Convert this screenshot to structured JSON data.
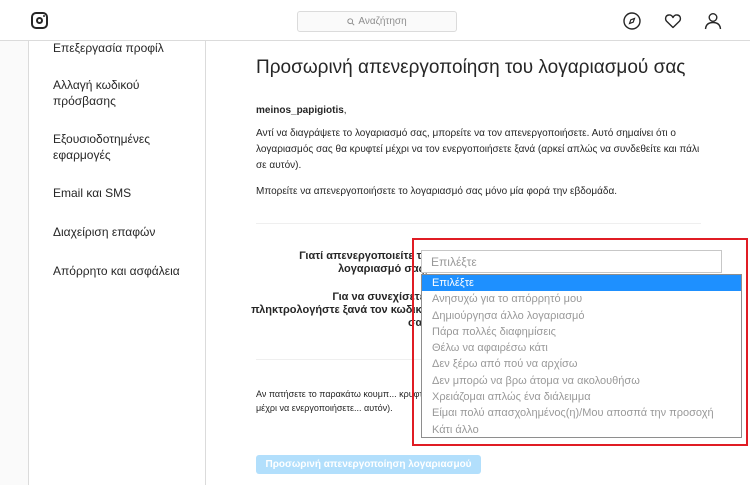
{
  "nav": {
    "search_placeholder": "Αναζήτηση",
    "icons": [
      "instagram-logo-icon",
      "search-icon",
      "compass-icon",
      "heart-icon",
      "profile-icon"
    ]
  },
  "sidebar": {
    "items": [
      {
        "label": "Επεξεργασία προφίλ"
      },
      {
        "label": "Αλλαγή κωδικού πρόσβασης"
      },
      {
        "label": "Εξουσιοδοτημένες εφαρμογές"
      },
      {
        "label": "Email και SMS"
      },
      {
        "label": "Διαχείριση επαφών"
      },
      {
        "label": "Απόρρητο και ασφάλεια"
      }
    ]
  },
  "main": {
    "title": "Προσωρινή απενεργοποίηση του λογαριασμού σας",
    "username": "meinos_papigiotis",
    "username_suffix": ",",
    "paragraph1": "Αντί να διαγράψετε το λογαριασμό σας, μπορείτε να τον απενεργοποιήσετε. Αυτό σημαίνει ότι ο λογαριασμός σας θα κρυφτεί μέχρι να τον ενεργοποιήσετε ξανά (αρκεί απλώς να συνδεθείτε και πάλι σε αυτόν).",
    "paragraph2": "Μπορείτε να απενεργοποιήσετε το λογαριασμό σας μόνο μία φορά την εβδομάδα.",
    "reason_label": "Γιατί απενεργοποιείτε το λογαριασμό σας;",
    "password_label": "Για να συνεχίσετε, πληκτρολογήστε ξανά τον κωδικό σας",
    "paragraph3": "Αν πατήσετε το παρακάτω κουμπ... κρυφτούν μέχρι να ενεργοποιήσετε... αυτόν).",
    "submit_label": "Προσωρινή απενεργοποίηση λογαριασμού"
  },
  "select": {
    "value": "Επιλέξτε",
    "options": [
      "Επιλέξτε",
      "Ανησυχώ για το απόρρητό μου",
      "Δημιούργησα άλλο λογαριασμό",
      "Πάρα πολλές διαφημίσεις",
      "Θέλω να αφαιρέσω κάτι",
      "Δεν ξέρω από πού να αρχίσω",
      "Δεν μπορώ να βρω άτομα να ακολουθήσω",
      "Χρειάζομαι απλώς ένα διάλειμμα",
      "Είμαι πολύ απασχολημένος(η)/Μου αποσπά την προσοχή",
      "Κάτι άλλο"
    ],
    "selected_index": 0
  },
  "colors": {
    "highlight": "#e01c24",
    "selected_option": "#1e90ff",
    "button": "#b2dffc"
  }
}
